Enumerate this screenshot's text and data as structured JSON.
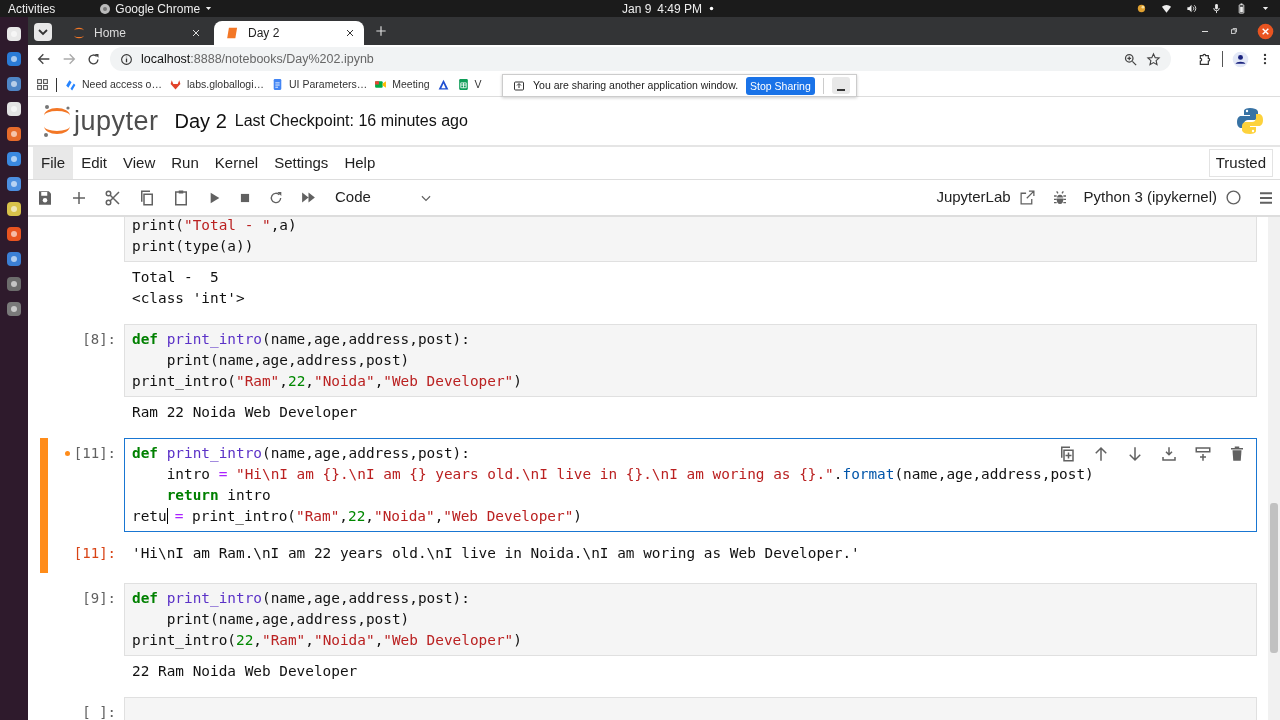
{
  "system_bar": {
    "activities": "Activities",
    "app_menu": "Google Chrome",
    "date": "Jan 9",
    "time": "4:49 PM"
  },
  "browser": {
    "tabs": [
      {
        "title": "Home",
        "selected": false
      },
      {
        "title": "Day 2",
        "selected": true
      }
    ],
    "url_host": "localhost",
    "url_rest": ":8888/notebooks/Day%202.ipynb",
    "bookmarks": [
      {
        "kind": "link",
        "label": "Need access o…"
      },
      {
        "kind": "link",
        "label": "labs.globallogi…"
      },
      {
        "kind": "link",
        "label": "UI Parameters…"
      },
      {
        "kind": "link",
        "label": "Meeting"
      },
      {
        "kind": "icon"
      },
      {
        "kind": "link",
        "label": "V"
      }
    ],
    "share_bar": {
      "message": "You are sharing another application window.",
      "button": "Stop Sharing"
    }
  },
  "notebook": {
    "logo": "jupyter",
    "title": "Day 2",
    "checkpoint": "Last Checkpoint: 16 minutes ago"
  },
  "menu": [
    {
      "label": "File",
      "selected": true
    },
    {
      "label": "Edit",
      "selected": false
    },
    {
      "label": "View",
      "selected": false
    },
    {
      "label": "Run",
      "selected": false
    },
    {
      "label": "Kernel",
      "selected": false
    },
    {
      "label": "Settings",
      "selected": false
    },
    {
      "label": "Help",
      "selected": false
    }
  ],
  "trusted": "Trusted",
  "toolbar": {
    "cell_type": "Code",
    "jupyterlab": "JupyterLab",
    "kernel": "Python 3 (ipykernel)"
  },
  "cells": [
    {
      "selected": false,
      "modified": false,
      "lines": [
        [
          {
            "kind": "plain",
            "text": "print("
          },
          {
            "kind": "string",
            "text": "\"Total - \""
          },
          {
            "kind": "plain",
            "text": ",a)"
          }
        ],
        [
          {
            "kind": "plain",
            "text": "print(type(a))"
          }
        ]
      ],
      "output": [
        "Total -  5",
        "<class 'int'>"
      ]
    },
    {
      "prompt": "[8]:",
      "selected": false,
      "modified": false,
      "lines": [
        [
          {
            "kind": "keyword",
            "text": "def"
          },
          {
            "kind": "defname",
            "text": " print_intro"
          },
          {
            "kind": "plain",
            "text": "(name,age,address,post):"
          }
        ],
        [
          {
            "kind": "plain",
            "text": "    print(name,age,address,post)"
          }
        ],
        [
          {
            "kind": "plain",
            "text": "print_intro("
          },
          {
            "kind": "string",
            "text": "\"Ram\""
          },
          {
            "kind": "plain",
            "text": ","
          },
          {
            "kind": "number",
            "text": "22"
          },
          {
            "kind": "plain",
            "text": ","
          },
          {
            "kind": "string",
            "text": "\"Noida\""
          },
          {
            "kind": "plain",
            "text": ","
          },
          {
            "kind": "string",
            "text": "\"Web Developer\""
          },
          {
            "kind": "plain",
            "text": ")"
          }
        ]
      ],
      "output": [
        "Ram 22 Noida Web Developer"
      ]
    },
    {
      "prompt": "[11]:",
      "selected": true,
      "modified": true,
      "lines": [
        [
          {
            "kind": "keyword",
            "text": "def"
          },
          {
            "kind": "defname",
            "text": " print_intro"
          },
          {
            "kind": "plain",
            "text": "(name,age,address,post):"
          }
        ],
        [
          {
            "kind": "plain",
            "text": "    intro "
          },
          {
            "kind": "operator",
            "text": "="
          },
          {
            "kind": "string",
            "text": " \"Hi\\nI am {}.\\nI am {} years old.\\nI live in {}.\\nI am woring as {}.\""
          },
          {
            "kind": "plain",
            "text": "."
          },
          {
            "kind": "property",
            "text": "format"
          },
          {
            "kind": "plain",
            "text": "(name,age,address,post)"
          }
        ],
        [
          {
            "kind": "keyword",
            "text": "    return"
          },
          {
            "kind": "plain",
            "text": " intro"
          }
        ],
        [
          {
            "kind": "plain",
            "text": "retu"
          },
          {
            "kind": "caret"
          },
          {
            "kind": "operator",
            "text": " ="
          },
          {
            "kind": "plain",
            "text": " print_intro("
          },
          {
            "kind": "string",
            "text": "\"Ram\""
          },
          {
            "kind": "plain",
            "text": ","
          },
          {
            "kind": "number",
            "text": "22"
          },
          {
            "kind": "plain",
            "text": ","
          },
          {
            "kind": "string",
            "text": "\"Noida\""
          },
          {
            "kind": "plain",
            "text": ","
          },
          {
            "kind": "string",
            "text": "\"Web Developer\""
          },
          {
            "kind": "plain",
            "text": ")"
          }
        ]
      ],
      "output_prompt": "[11]:",
      "output": [
        "'Hi\\nI am Ram.\\nI am 22 years old.\\nI live in Noida.\\nI am woring as Web Developer.'"
      ]
    },
    {
      "prompt": "[9]:",
      "selected": false,
      "modified": false,
      "lines": [
        [
          {
            "kind": "keyword",
            "text": "def"
          },
          {
            "kind": "defname",
            "text": " print_intro"
          },
          {
            "kind": "plain",
            "text": "(name,age,address,post):"
          }
        ],
        [
          {
            "kind": "plain",
            "text": "    print(name,age,address,post)"
          }
        ],
        [
          {
            "kind": "plain",
            "text": "print_intro("
          },
          {
            "kind": "number",
            "text": "22"
          },
          {
            "kind": "plain",
            "text": ","
          },
          {
            "kind": "string",
            "text": "\"Ram\""
          },
          {
            "kind": "plain",
            "text": ","
          },
          {
            "kind": "string",
            "text": "\"Noida\""
          },
          {
            "kind": "plain",
            "text": ","
          },
          {
            "kind": "string",
            "text": "\"Web Developer\""
          },
          {
            "kind": "plain",
            "text": ")"
          }
        ]
      ],
      "output": [
        "22 Ram Noida Web Developer"
      ]
    },
    {
      "prompt": "[ ]:",
      "selected": false,
      "modified": false
    }
  ]
}
